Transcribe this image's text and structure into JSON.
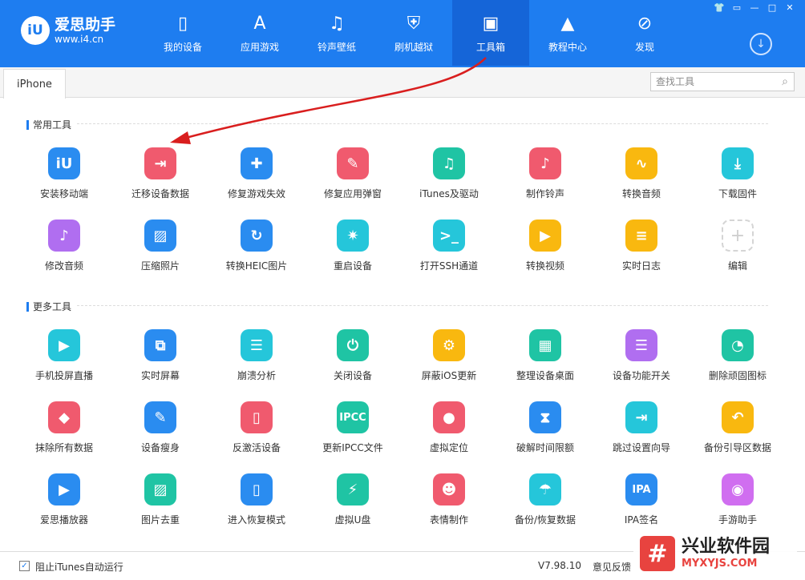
{
  "app": {
    "name": "爱思助手",
    "url": "www.i4.cn",
    "badge": "iU"
  },
  "window_controls": [
    "👕",
    "▭",
    "—",
    "□",
    "✕"
  ],
  "nav": [
    {
      "label": "我的设备",
      "icon": "phone-icon",
      "glyph": "▯"
    },
    {
      "label": "应用游戏",
      "icon": "appstore-icon",
      "glyph": "A"
    },
    {
      "label": "铃声壁纸",
      "icon": "music-icon",
      "glyph": "♫"
    },
    {
      "label": "刷机越狱",
      "icon": "shield-icon",
      "glyph": "⛨"
    },
    {
      "label": "工具箱",
      "icon": "toolbox-icon",
      "glyph": "▣"
    },
    {
      "label": "教程中心",
      "icon": "graduation-icon",
      "glyph": "▲"
    },
    {
      "label": "发现",
      "icon": "compass-icon",
      "glyph": "⊘"
    }
  ],
  "active_nav_index": 4,
  "download_icon": "↓",
  "tab": {
    "label": "iPhone"
  },
  "search": {
    "placeholder": "查找工具",
    "icon": "⌕"
  },
  "sections": {
    "common_title": "常用工具",
    "more_title": "更多工具"
  },
  "common_tools": [
    {
      "label": "安装移动端",
      "icon": "i4-logo-icon",
      "glyph": "iU",
      "color": "#2a8cf0"
    },
    {
      "label": "迁移设备数据",
      "icon": "migrate-icon",
      "glyph": "⇥",
      "color": "#f05a6e"
    },
    {
      "label": "修复游戏失效",
      "icon": "gamepad-icon",
      "glyph": "✚",
      "color": "#2a8cf0"
    },
    {
      "label": "修复应用弹窗",
      "icon": "wrench-icon",
      "glyph": "✎",
      "color": "#f05a6e"
    },
    {
      "label": "iTunes及驱动",
      "icon": "itunes-icon",
      "glyph": "♫",
      "color": "#1fc4a4"
    },
    {
      "label": "制作铃声",
      "icon": "ringtone-icon",
      "glyph": "♪",
      "color": "#f05a6e"
    },
    {
      "label": "转换音频",
      "icon": "waveform-icon",
      "glyph": "∿",
      "color": "#f9b80f"
    },
    {
      "label": "下载固件",
      "icon": "download-box-icon",
      "glyph": "⤓",
      "color": "#25c6da"
    },
    {
      "label": "修改音频",
      "icon": "audio-edit-icon",
      "glyph": "♪",
      "color": "#b06ef0"
    },
    {
      "label": "压缩照片",
      "icon": "photo-icon",
      "glyph": "▨",
      "color": "#2a8cf0"
    },
    {
      "label": "转换HEIC图片",
      "icon": "heic-icon",
      "glyph": "↻",
      "color": "#2a8cf0"
    },
    {
      "label": "重启设备",
      "icon": "restart-icon",
      "glyph": "✷",
      "color": "#25c6da"
    },
    {
      "label": "打开SSH通道",
      "icon": "terminal-icon",
      "glyph": ">_",
      "color": "#25c6da"
    },
    {
      "label": "转换视频",
      "icon": "video-icon",
      "glyph": "▶",
      "color": "#f9b80f"
    },
    {
      "label": "实时日志",
      "icon": "log-icon",
      "glyph": "≡",
      "color": "#f9b80f"
    },
    {
      "label": "编辑",
      "icon": "add-icon",
      "glyph": "+",
      "color": "",
      "plus": true
    }
  ],
  "more_tools": [
    {
      "label": "手机投屏直播",
      "icon": "screencast-icon",
      "glyph": "▶",
      "color": "#25c6da"
    },
    {
      "label": "实时屏幕",
      "icon": "realtime-screen-icon",
      "glyph": "⧉",
      "color": "#2a8cf0"
    },
    {
      "label": "崩溃分析",
      "icon": "crash-report-icon",
      "glyph": "☰",
      "color": "#25c6da"
    },
    {
      "label": "关闭设备",
      "icon": "power-icon",
      "glyph": "⏻",
      "color": "#1fc4a4"
    },
    {
      "label": "屏蔽iOS更新",
      "icon": "block-update-icon",
      "glyph": "⚙",
      "color": "#f9b80f"
    },
    {
      "label": "整理设备桌面",
      "icon": "grid-icon",
      "glyph": "▦",
      "color": "#1fc4a4"
    },
    {
      "label": "设备功能开关",
      "icon": "toggle-icon",
      "glyph": "☰",
      "color": "#b06ef0"
    },
    {
      "label": "删除顽固图标",
      "icon": "pie-icon",
      "glyph": "◔",
      "color": "#1fc4a4"
    },
    {
      "label": "抹除所有数据",
      "icon": "eraser-icon",
      "glyph": "◆",
      "color": "#f05a6e"
    },
    {
      "label": "设备瘦身",
      "icon": "broom-icon",
      "glyph": "✎",
      "color": "#2a8cf0"
    },
    {
      "label": "反激活设备",
      "icon": "deactivate-icon",
      "glyph": "▯",
      "color": "#f05a6e"
    },
    {
      "label": "更新IPCC文件",
      "icon": "ipcc-icon",
      "glyph": "IPCC",
      "color": "#1fc4a4"
    },
    {
      "label": "虚拟定位",
      "icon": "location-icon",
      "glyph": "●",
      "color": "#f05a6e"
    },
    {
      "label": "破解时间限额",
      "icon": "hourglass-icon",
      "glyph": "⧗",
      "color": "#2a8cf0"
    },
    {
      "label": "跳过设置向导",
      "icon": "skip-setup-icon",
      "glyph": "⇥",
      "color": "#25c6da"
    },
    {
      "label": "备份引导区数据",
      "icon": "backup-boot-icon",
      "glyph": "↶",
      "color": "#f9b80f"
    },
    {
      "label": "爱思播放器",
      "icon": "player-icon",
      "glyph": "▶",
      "color": "#2a8cf0"
    },
    {
      "label": "图片去重",
      "icon": "dedupe-photo-icon",
      "glyph": "▨",
      "color": "#1fc4a4"
    },
    {
      "label": "进入恢复模式",
      "icon": "recovery-icon",
      "glyph": "▯",
      "color": "#2a8cf0"
    },
    {
      "label": "虚拟U盘",
      "icon": "usb-icon",
      "glyph": "⚡",
      "color": "#1fc4a4"
    },
    {
      "label": "表情制作",
      "icon": "emoji-icon",
      "glyph": "☻",
      "color": "#f05a6e"
    },
    {
      "label": "备份/恢复数据",
      "icon": "umbrella-icon",
      "glyph": "☂",
      "color": "#25c6da"
    },
    {
      "label": "IPA签名",
      "icon": "ipa-icon",
      "glyph": "IPA",
      "color": "#2a8cf0"
    },
    {
      "label": "手游助手",
      "icon": "game-helper-icon",
      "glyph": "◉",
      "color": "#d06ef0"
    }
  ],
  "footer": {
    "checkbox_label": "阻止iTunes自动运行",
    "checkbox_checked": true,
    "checkmark": "✓",
    "version": "V7.98.10",
    "feedback": "意见反馈"
  },
  "watermark": {
    "logo": "#",
    "text": "兴业软件园",
    "url": "MYXYJS.COM"
  }
}
